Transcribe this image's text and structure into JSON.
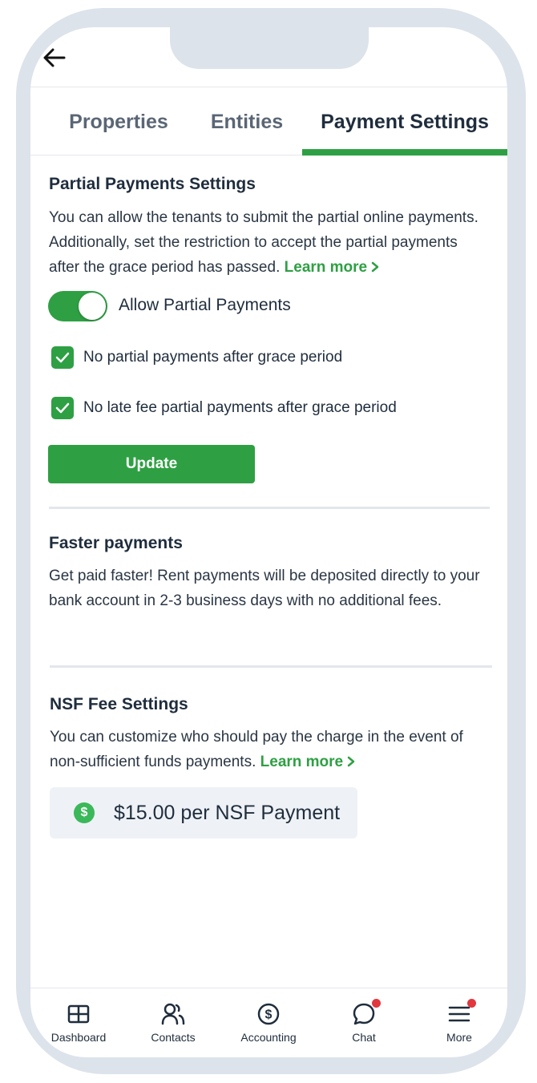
{
  "header": {
    "back_icon": "arrow-left-icon"
  },
  "tabs": [
    {
      "label": "Properties",
      "active": false
    },
    {
      "label": "Entities",
      "active": false
    },
    {
      "label": "Payment Settings",
      "active": true
    }
  ],
  "partial_payments": {
    "title": "Partial Payments Settings",
    "description": "You can allow the tenants to submit the partial online payments. Additionally, set the restriction to accept the partial payments after the grace period has passed.",
    "learn_more": "Learn more",
    "toggle_label": "Allow Partial Payments",
    "toggle_on": true,
    "options": [
      {
        "label": "No partial payments after grace period",
        "checked": true
      },
      {
        "label": "No late fee partial payments after grace period",
        "checked": true
      }
    ],
    "update_button": "Update"
  },
  "faster_payments": {
    "title": "Faster payments",
    "description": "Get paid faster! Rent payments will be deposited directly to your bank account in 2-3 business days with no additional fees."
  },
  "nsf": {
    "title": "NSF Fee Settings",
    "description": "You can customize who should pay the charge in the event of non-sufficient funds payments.",
    "learn_more": "Learn more",
    "fee_label": "$15.00 per NSF Payment",
    "fee_icon": "dollar-circle-icon"
  },
  "bottom_nav": [
    {
      "label": "Dashboard",
      "icon": "dashboard-grid-icon",
      "badge": false
    },
    {
      "label": "Contacts",
      "icon": "contacts-icon",
      "badge": false
    },
    {
      "label": "Accounting",
      "icon": "dollar-circle-icon",
      "badge": false
    },
    {
      "label": "Chat",
      "icon": "chat-bubble-icon",
      "badge": true
    },
    {
      "label": "More",
      "icon": "hamburger-menu-icon",
      "badge": true
    }
  ],
  "colors": {
    "accent": "#2ea043",
    "badge": "#e0383e",
    "frame": "#dde3eb",
    "text": "#1f2d3d"
  }
}
